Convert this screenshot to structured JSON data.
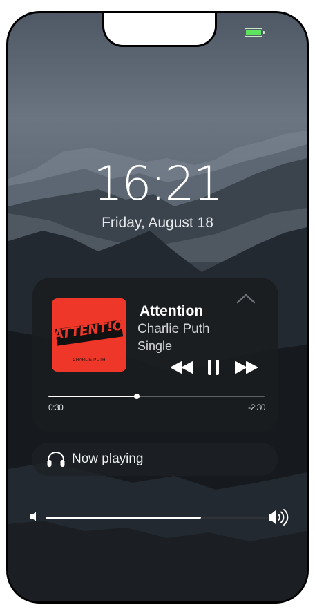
{
  "status_bar": {
    "battery_icon": "battery-full-icon",
    "battery_color": "#5ee35e"
  },
  "lockscreen": {
    "time": "16:21",
    "date": "Friday, August 18"
  },
  "player": {
    "artwork_text": "ATTENT!ON",
    "artwork_artist": "CHARLIE PUTH",
    "artwork_color": "#ee3729",
    "title": "Attention",
    "artist": "Charlie Puth",
    "album": "Single",
    "collapse_icon": "chevron-up-icon",
    "controls": {
      "previous_icon": "rewind-icon",
      "pause_icon": "pause-icon",
      "next_icon": "fast-forward-icon"
    },
    "progress_fraction": 0.41,
    "elapsed": "0:30",
    "remaining": "-2:30"
  },
  "now_playing": {
    "icon": "headphones-icon",
    "label": "Now playing"
  },
  "volume": {
    "level_fraction": 0.7,
    "low_icon": "speaker-low-icon",
    "high_icon": "speaker-high-icon"
  }
}
